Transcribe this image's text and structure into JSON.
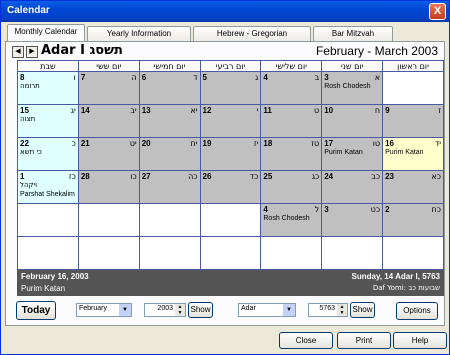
{
  "window": {
    "title": "Calendar",
    "close_glyph": "X"
  },
  "tabs": [
    {
      "label": "Monthly Calendar"
    },
    {
      "label": "Yearly Information"
    },
    {
      "label": "Hebrew - Gregorian"
    },
    {
      "label": "Bar Mitzvah"
    }
  ],
  "header": {
    "prev_glyph": "◀",
    "next_glyph": "▶",
    "hebrew_month": "תשסג Adar I",
    "gregorian_range": "February  - March 2003"
  },
  "weekdays": [
    "שבת",
    "יום ששי",
    "יום חמישי",
    "יום רביעי",
    "יום שלישי",
    "יום שני",
    "יום ראשון"
  ],
  "weeks": [
    [
      {
        "greg": "8",
        "heb": "ו",
        "event": "תרומה",
        "event_rtl": true,
        "style": "c"
      },
      {
        "greg": "7",
        "heb": "ה",
        "event": "",
        "style": "g"
      },
      {
        "greg": "6",
        "heb": "ד",
        "event": "",
        "style": "g"
      },
      {
        "greg": "5",
        "heb": "ג",
        "event": "",
        "style": "g"
      },
      {
        "greg": "4",
        "heb": "ב",
        "event": "",
        "style": "g"
      },
      {
        "greg": "3",
        "heb": "א",
        "event": "Rosh Chodesh",
        "style": "g"
      },
      {
        "greg": "",
        "heb": "",
        "event": "",
        "style": "w"
      }
    ],
    [
      {
        "greg": "15",
        "heb": "יג",
        "event": "תצוה",
        "event_rtl": true,
        "style": "c"
      },
      {
        "greg": "14",
        "heb": "יב",
        "event": "",
        "style": "g"
      },
      {
        "greg": "13",
        "heb": "יא",
        "event": "",
        "style": "g"
      },
      {
        "greg": "12",
        "heb": "י",
        "event": "",
        "style": "g"
      },
      {
        "greg": "11",
        "heb": "ט",
        "event": "",
        "style": "g"
      },
      {
        "greg": "10",
        "heb": "ח",
        "event": "",
        "style": "g"
      },
      {
        "greg": "9",
        "heb": "ז",
        "event": "",
        "style": "g"
      }
    ],
    [
      {
        "greg": "22",
        "heb": "כ",
        "event": "כי תשא",
        "event_rtl": true,
        "style": "c"
      },
      {
        "greg": "21",
        "heb": "יט",
        "event": "",
        "style": "g"
      },
      {
        "greg": "20",
        "heb": "יח",
        "event": "",
        "style": "g"
      },
      {
        "greg": "19",
        "heb": "יז",
        "event": "",
        "style": "g"
      },
      {
        "greg": "18",
        "heb": "טז",
        "event": "",
        "style": "g"
      },
      {
        "greg": "17",
        "heb": "טו",
        "event": "Purim Katan",
        "style": "g"
      },
      {
        "greg": "16",
        "heb": "יד",
        "event": "Purim Katan",
        "style": "y"
      }
    ],
    [
      {
        "greg": "1",
        "heb": "כז",
        "event": "ויקהל",
        "event2": "Parshat Shekalim",
        "event_rtl": true,
        "style": "c"
      },
      {
        "greg": "28",
        "heb": "כו",
        "event": "",
        "style": "g"
      },
      {
        "greg": "27",
        "heb": "כה",
        "event": "",
        "style": "g"
      },
      {
        "greg": "26",
        "heb": "כד",
        "event": "",
        "style": "g"
      },
      {
        "greg": "25",
        "heb": "כג",
        "event": "",
        "style": "g"
      },
      {
        "greg": "24",
        "heb": "כב",
        "event": "",
        "style": "g"
      },
      {
        "greg": "23",
        "heb": "כא",
        "event": "",
        "style": "g"
      }
    ],
    [
      {
        "greg": "",
        "heb": "",
        "event": "",
        "style": "w"
      },
      {
        "greg": "",
        "heb": "",
        "event": "",
        "style": "w"
      },
      {
        "greg": "",
        "heb": "",
        "event": "",
        "style": "w"
      },
      {
        "greg": "",
        "heb": "",
        "event": "",
        "style": "w"
      },
      {
        "greg": "4",
        "heb": "ל",
        "event": "Rosh Chodesh",
        "style": "g"
      },
      {
        "greg": "3",
        "heb": "כט",
        "event": "",
        "style": "g"
      },
      {
        "greg": "2",
        "heb": "כח",
        "event": "",
        "style": "g"
      }
    ],
    [
      {
        "greg": "",
        "heb": "",
        "event": "",
        "style": "w"
      },
      {
        "greg": "",
        "heb": "",
        "event": "",
        "style": "w"
      },
      {
        "greg": "",
        "heb": "",
        "event": "",
        "style": "w"
      },
      {
        "greg": "",
        "heb": "",
        "event": "",
        "style": "w"
      },
      {
        "greg": "",
        "heb": "",
        "event": "",
        "style": "w"
      },
      {
        "greg": "",
        "heb": "",
        "event": "",
        "style": "w"
      },
      {
        "greg": "",
        "heb": "",
        "event": "",
        "style": "w"
      }
    ]
  ],
  "status": {
    "greg_date": "February 16, 2003",
    "event": "Purim Katan",
    "heb_date": "Sunday, 14 Adar I, 5763",
    "daf_yomi": "Daf Yomi: שבועות כב"
  },
  "controls": {
    "today_label": "Today",
    "month_value": "February",
    "greg_year": "2003",
    "show_label": "Show",
    "heb_month_value": "Adar",
    "heb_year": "5763",
    "show2_label": "Show",
    "options_label": "Options",
    "arrow_glyph": "▼",
    "spin_up": "▲",
    "spin_down": "▼"
  },
  "footer": {
    "close_label": "Close",
    "print_label": "Print",
    "help_label": "Help"
  },
  "colors": {
    "title_bar": "#0046d5",
    "weekday_cell": "#c0c0c0",
    "shabbat_cell": "#e0ffff",
    "selected_cell": "#ffffcc",
    "status_bar": "#555555"
  }
}
